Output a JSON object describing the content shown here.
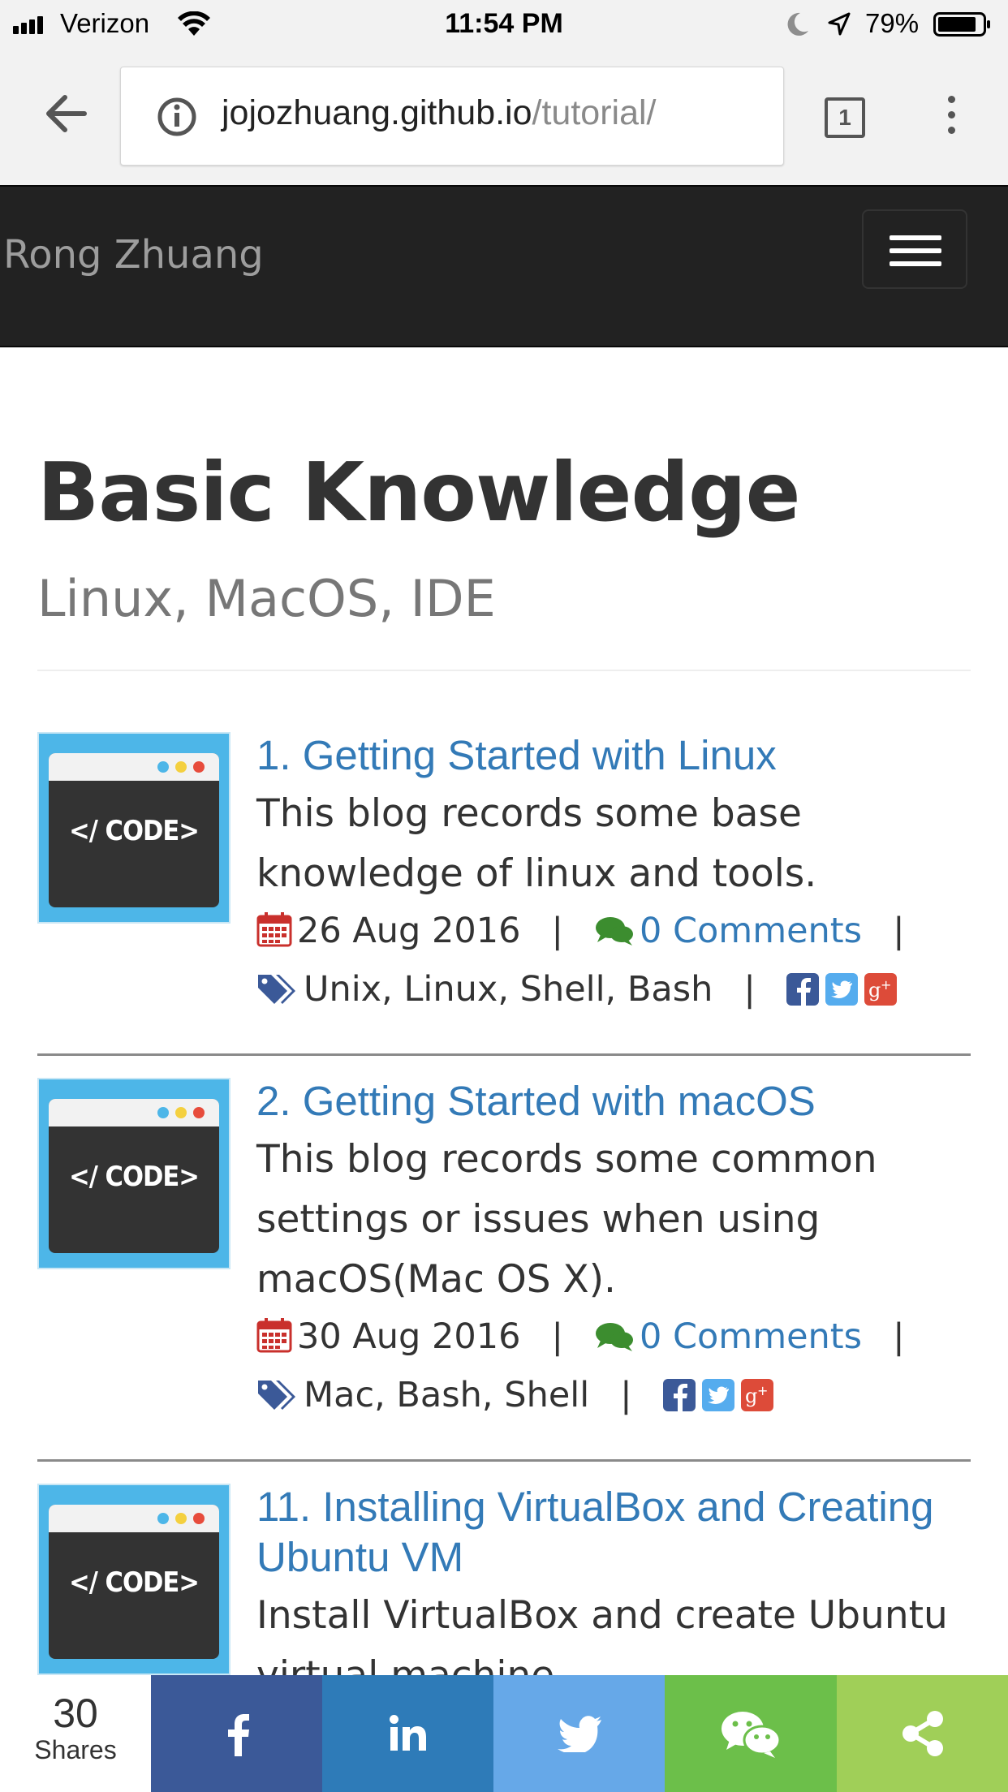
{
  "status_bar": {
    "carrier": "Verizon",
    "time": "11:54 PM",
    "battery": "79%",
    "icons": [
      "signal-icon",
      "wifi-icon",
      "moon-icon",
      "location-arrow-icon",
      "battery-icon"
    ]
  },
  "browser": {
    "url_host": "jojozhuang.github.io",
    "url_path": "/tutorial/",
    "tab_count": "1",
    "icons": [
      "back-arrow-icon",
      "info-icon",
      "tabs-icon",
      "overflow-menu-icon"
    ]
  },
  "navbar": {
    "brand": "Rong Zhuang",
    "icons": [
      "hamburger-menu-icon"
    ]
  },
  "header": {
    "title": "Basic Knowledge",
    "subtitle": "Linux, MacOS, IDE"
  },
  "thumb_label": "</ CODE>",
  "posts": [
    {
      "title": "1. Getting Started with Linux",
      "excerpt": "This blog records some base knowledge of linux and tools.",
      "date": "26 Aug 2016",
      "comments": "0 Comments",
      "tags": "Unix, Linux, Shell, Bash"
    },
    {
      "title": "2. Getting Started with macOS",
      "excerpt": "This blog records some common settings or issues when using macOS(Mac OS X).",
      "date": "30 Aug 2016",
      "comments": "0 Comments",
      "tags": "Mac, Bash, Shell"
    },
    {
      "title": "11. Installing VirtualBox and Creating Ubuntu VM",
      "excerpt": "Install VirtualBox and create Ubuntu virtual machine."
    }
  ],
  "meta_separator": "|",
  "share_bar": {
    "count": "30",
    "label": "Shares",
    "buttons": [
      "facebook",
      "linkedin",
      "twitter",
      "wechat",
      "share"
    ]
  },
  "colors": {
    "link": "#337ab7",
    "navbar": "#222222",
    "calendar": "#c9302c",
    "comment": "#3c8d2f",
    "tag": "#3b5998",
    "facebook": "#3b5998",
    "twitter": "#55acee",
    "google_plus": "#dd4b39",
    "share_facebook": "#3b5998",
    "share_linkedin": "#0077b5",
    "share_twitter": "#55acee",
    "share_wechat": "#4ec034",
    "share_generic": "#95d03a"
  }
}
